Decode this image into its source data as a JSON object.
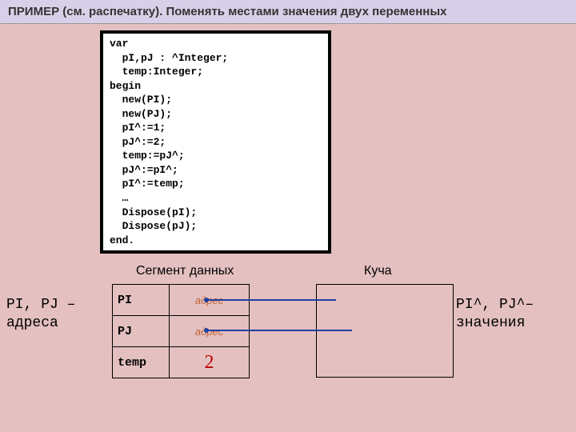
{
  "title": "ПРИМЕР (см. распечатку).  Поменять местами значения двух переменных",
  "code": "var\n  pI,pJ : ^Integer;\n  temp:Integer;\nbegin\n  new(PI);\n  new(PJ);\n  pI^:=1;\n  pJ^:=2;\n  temp:=pJ^;\n  pJ^:=pI^;\n  pI^:=temp;\n  …\n  Dispose(pI);\n  Dispose(pJ);\nend.",
  "labels": {
    "data_segment": "Сегмент данных",
    "heap": "Куча"
  },
  "left_note_line1": "PI, PJ –",
  "left_note_line2": "адреса",
  "right_note_line1": "PI^, PJ^–",
  "right_note_line2": "значения",
  "data_seg": {
    "rows": [
      {
        "label": "PI",
        "value": "адрес",
        "kind": "addr"
      },
      {
        "label": "PJ",
        "value": "адрес",
        "kind": "addr"
      },
      {
        "label": "temp",
        "value": "2",
        "kind": "val"
      }
    ]
  }
}
